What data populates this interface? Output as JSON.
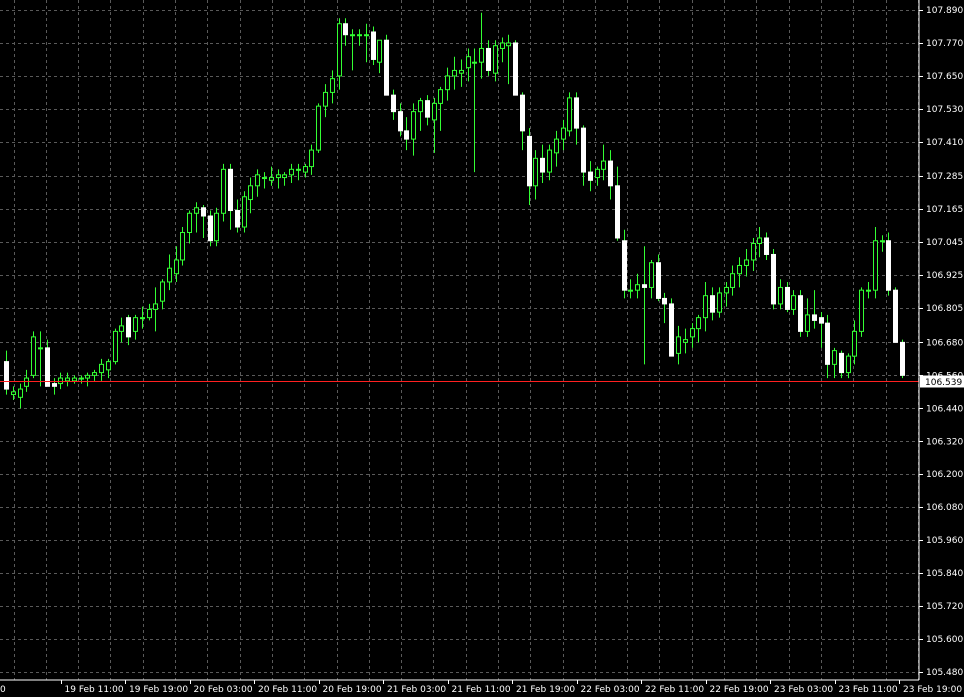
{
  "chart_data": {
    "type": "candlestick",
    "colors": {
      "background": "#000000",
      "grid": "#5a5a5a",
      "axis_text": "#ffffff",
      "bull_body": "#000000",
      "bull_outline": "#33ff33",
      "bear_body": "#ffffff",
      "bear_outline": "#ffffff",
      "wick": "#33ff33",
      "current_price_line": "#ff2020",
      "current_price_label_bg": "#ffffff",
      "current_price_label_text": "#000000"
    },
    "grid": true,
    "ylim": [
      106.415,
      107.955
    ],
    "y_ticks": [
      "107.890",
      "107.770",
      "107.650",
      "107.530",
      "107.410",
      "107.285",
      "107.165",
      "107.045",
      "106.925",
      "106.805",
      "106.680",
      "106.560",
      "106.440",
      "106.320",
      "106.200",
      "106.080",
      "105.960",
      "105.840",
      "105.720",
      "105.600",
      "105.480"
    ],
    "x_labels": [
      "0",
      "19 Feb 11:00",
      "19 Feb 19:00",
      "20 Feb 03:00",
      "20 Feb 11:00",
      "20 Feb 19:00",
      "21 Feb 03:00",
      "21 Feb 11:00",
      "21 Feb 19:00",
      "22 Feb 03:00",
      "22 Feb 11:00",
      "22 Feb 19:00",
      "23 Feb 03:00",
      "23 Feb 11:00",
      "23 Feb 19:00"
    ],
    "current_price": "106.539",
    "candles": [
      [
        106.61,
        106.65,
        106.49,
        106.51
      ],
      [
        106.49,
        106.52,
        106.47,
        106.5
      ],
      [
        106.48,
        106.53,
        106.44,
        106.51
      ],
      [
        106.52,
        106.58,
        106.5,
        106.55
      ],
      [
        106.56,
        106.72,
        106.55,
        106.7
      ],
      [
        106.66,
        106.72,
        106.52,
        106.66
      ],
      [
        106.66,
        106.69,
        106.52,
        106.52
      ],
      [
        106.53,
        106.55,
        106.49,
        106.52
      ],
      [
        106.53,
        106.57,
        106.51,
        106.55
      ],
      [
        106.54,
        106.57,
        106.52,
        106.55
      ],
      [
        106.54,
        106.56,
        106.53,
        106.55
      ],
      [
        106.55,
        106.56,
        106.53,
        106.55
      ],
      [
        106.55,
        106.57,
        106.52,
        106.56
      ],
      [
        106.56,
        106.58,
        106.54,
        106.57
      ],
      [
        106.57,
        106.62,
        106.54,
        106.6
      ],
      [
        106.58,
        106.62,
        106.55,
        106.61
      ],
      [
        106.61,
        106.73,
        106.6,
        106.72
      ],
      [
        106.72,
        106.77,
        106.68,
        106.74
      ],
      [
        106.77,
        106.78,
        106.67,
        106.7
      ],
      [
        106.72,
        106.78,
        106.69,
        106.77
      ],
      [
        106.77,
        106.81,
        106.73,
        106.77
      ],
      [
        106.77,
        106.82,
        106.76,
        106.8
      ],
      [
        106.8,
        106.88,
        106.72,
        106.82
      ],
      [
        106.83,
        106.91,
        106.8,
        106.9
      ],
      [
        106.9,
        107.0,
        106.87,
        106.95
      ],
      [
        106.93,
        107.03,
        106.9,
        106.98
      ],
      [
        106.98,
        107.1,
        106.96,
        107.08
      ],
      [
        107.08,
        107.16,
        107.04,
        107.15
      ],
      [
        107.15,
        107.19,
        107.08,
        107.17
      ],
      [
        107.17,
        107.18,
        107.06,
        107.14
      ],
      [
        107.14,
        107.16,
        107.03,
        107.05
      ],
      [
        107.05,
        107.17,
        107.03,
        107.15
      ],
      [
        107.15,
        107.33,
        107.12,
        107.31
      ],
      [
        107.31,
        107.33,
        107.09,
        107.16
      ],
      [
        107.16,
        107.2,
        107.08,
        107.1
      ],
      [
        107.1,
        107.23,
        107.08,
        107.21
      ],
      [
        107.2,
        107.28,
        107.15,
        107.25
      ],
      [
        107.25,
        107.31,
        107.21,
        107.29
      ],
      [
        107.28,
        107.3,
        107.24,
        107.28
      ],
      [
        107.27,
        107.32,
        107.25,
        107.28
      ],
      [
        107.28,
        107.31,
        107.24,
        107.29
      ],
      [
        107.28,
        107.3,
        107.25,
        107.29
      ],
      [
        107.29,
        107.33,
        107.26,
        107.31
      ],
      [
        107.31,
        107.33,
        107.27,
        107.31
      ],
      [
        107.3,
        107.33,
        107.28,
        107.32
      ],
      [
        107.32,
        107.4,
        107.29,
        107.38
      ],
      [
        107.38,
        107.55,
        107.37,
        107.54
      ],
      [
        107.54,
        107.62,
        107.5,
        107.59
      ],
      [
        107.59,
        107.67,
        107.55,
        107.64
      ],
      [
        107.65,
        107.86,
        107.6,
        107.84
      ],
      [
        107.84,
        107.86,
        107.76,
        107.8
      ],
      [
        107.8,
        107.82,
        107.67,
        107.8
      ],
      [
        107.8,
        107.82,
        107.76,
        107.8
      ],
      [
        107.8,
        107.84,
        107.7,
        107.8
      ],
      [
        107.81,
        107.83,
        107.69,
        107.71
      ],
      [
        107.7,
        107.78,
        107.66,
        107.78
      ],
      [
        107.78,
        107.8,
        107.58,
        107.58
      ],
      [
        107.58,
        107.6,
        107.49,
        107.52
      ],
      [
        107.52,
        107.55,
        107.43,
        107.45
      ],
      [
        107.45,
        107.5,
        107.38,
        107.42
      ],
      [
        107.42,
        107.55,
        107.36,
        107.52
      ],
      [
        107.52,
        107.57,
        107.45,
        107.56
      ],
      [
        107.56,
        107.58,
        107.47,
        107.5
      ],
      [
        107.49,
        107.57,
        107.37,
        107.55
      ],
      [
        107.55,
        107.61,
        107.45,
        107.6
      ],
      [
        107.6,
        107.68,
        107.56,
        107.65
      ],
      [
        107.65,
        107.72,
        107.6,
        107.67
      ],
      [
        107.66,
        107.71,
        107.61,
        107.67
      ],
      [
        107.68,
        107.75,
        107.63,
        107.72
      ],
      [
        107.7,
        107.75,
        107.3,
        107.7
      ],
      [
        107.7,
        107.88,
        107.64,
        107.75
      ],
      [
        107.75,
        107.78,
        107.65,
        107.67
      ],
      [
        107.66,
        107.78,
        107.63,
        107.76
      ],
      [
        107.75,
        107.79,
        107.7,
        107.77
      ],
      [
        107.76,
        107.8,
        107.62,
        107.77
      ],
      [
        107.77,
        107.78,
        107.58,
        107.58
      ],
      [
        107.58,
        107.59,
        107.38,
        107.45
      ],
      [
        107.43,
        107.46,
        107.18,
        107.25
      ],
      [
        107.25,
        107.38,
        107.2,
        107.35
      ],
      [
        107.35,
        107.4,
        107.26,
        107.3
      ],
      [
        107.3,
        107.4,
        107.27,
        107.38
      ],
      [
        107.37,
        107.45,
        107.32,
        107.42
      ],
      [
        107.42,
        107.49,
        107.38,
        107.46
      ],
      [
        107.45,
        107.59,
        107.43,
        107.57
      ],
      [
        107.57,
        107.59,
        107.4,
        107.46
      ],
      [
        107.46,
        107.47,
        107.25,
        107.3
      ],
      [
        107.3,
        107.34,
        107.23,
        107.27
      ],
      [
        107.28,
        107.32,
        107.25,
        107.31
      ],
      [
        107.31,
        107.4,
        107.27,
        107.34
      ],
      [
        107.34,
        107.38,
        107.2,
        107.25
      ],
      [
        107.25,
        107.32,
        107.05,
        107.06
      ],
      [
        107.05,
        107.09,
        106.84,
        106.87
      ],
      [
        106.87,
        106.91,
        106.84,
        106.87
      ],
      [
        106.87,
        106.93,
        106.84,
        106.89
      ],
      [
        106.89,
        107.03,
        106.6,
        106.88
      ],
      [
        106.88,
        106.98,
        106.84,
        106.97
      ],
      [
        106.97,
        107.0,
        106.83,
        106.84
      ],
      [
        106.84,
        106.86,
        106.75,
        106.82
      ],
      [
        106.82,
        106.84,
        106.63,
        106.63
      ],
      [
        106.64,
        106.74,
        106.6,
        106.7
      ],
      [
        106.68,
        106.73,
        106.64,
        106.69
      ],
      [
        106.7,
        106.75,
        106.66,
        106.73
      ],
      [
        106.73,
        106.78,
        106.68,
        106.77
      ],
      [
        106.77,
        106.9,
        106.72,
        106.85
      ],
      [
        106.85,
        106.88,
        106.76,
        106.79
      ],
      [
        106.79,
        106.88,
        106.77,
        106.86
      ],
      [
        106.86,
        106.9,
        106.81,
        106.88
      ],
      [
        106.88,
        106.96,
        106.85,
        106.93
      ],
      [
        106.93,
        106.99,
        106.88,
        106.96
      ],
      [
        106.96,
        107.02,
        106.92,
        106.98
      ],
      [
        106.98,
        107.06,
        106.94,
        107.04
      ],
      [
        107.04,
        107.1,
        106.99,
        107.06
      ],
      [
        107.06,
        107.08,
        106.98,
        107.0
      ],
      [
        107.0,
        107.02,
        106.8,
        106.82
      ],
      [
        106.82,
        106.91,
        106.8,
        106.88
      ],
      [
        106.88,
        106.9,
        106.79,
        106.8
      ],
      [
        106.8,
        106.87,
        106.78,
        106.85
      ],
      [
        106.85,
        106.87,
        106.7,
        106.72
      ],
      [
        106.72,
        106.84,
        106.7,
        106.78
      ],
      [
        106.78,
        106.87,
        106.73,
        106.76
      ],
      [
        106.77,
        106.79,
        106.66,
        106.75
      ],
      [
        106.75,
        106.78,
        106.55,
        106.6
      ],
      [
        106.6,
        106.66,
        106.55,
        106.65
      ],
      [
        106.64,
        106.65,
        106.55,
        106.57
      ],
      [
        106.57,
        106.64,
        106.55,
        106.63
      ],
      [
        106.63,
        106.76,
        106.6,
        106.72
      ],
      [
        106.72,
        106.88,
        106.7,
        106.87
      ],
      [
        106.87,
        106.9,
        106.84,
        106.87
      ],
      [
        106.87,
        107.1,
        106.84,
        107.05
      ],
      [
        107.05,
        107.07,
        107.01,
        107.05
      ],
      [
        107.05,
        107.08,
        106.85,
        106.87
      ],
      [
        106.87,
        106.88,
        106.68,
        106.68
      ],
      [
        106.68,
        106.69,
        106.55,
        106.56
      ]
    ]
  }
}
